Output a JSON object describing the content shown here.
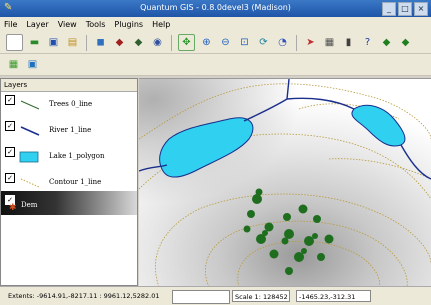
{
  "window": {
    "title": "Quantum GIS - 0.8.0devel3 (Madison)"
  },
  "menu": [
    "File",
    "Layer",
    "View",
    "Tools",
    "Plugins",
    "Help"
  ],
  "toolbar1": [
    "new-project",
    "open-project",
    "save-project",
    "save-as",
    "print",
    "add-vector",
    "add-raster",
    "add-postgis",
    "pan",
    "zoom-in",
    "zoom-out",
    "zoom-full",
    "zoom-last",
    "refresh",
    "identify",
    "measure",
    "select",
    "whats-this",
    "capture-point",
    "capture-line"
  ],
  "toolbar2": [
    "grid-plugin",
    "map-plugin"
  ],
  "layers_panel": {
    "header": "Layers",
    "items": [
      {
        "name": "Trees 0_line",
        "checked": true,
        "symbol": "thin-line",
        "color": "#2d6b2d"
      },
      {
        "name": "River 1_line",
        "checked": true,
        "symbol": "line",
        "color": "#1a2f8c"
      },
      {
        "name": "Lake 1_polygon",
        "checked": true,
        "symbol": "polygon",
        "color": "#2fd0f0"
      },
      {
        "name": "Contour 1_line",
        "checked": true,
        "symbol": "dashed-line",
        "color": "#c8a840"
      },
      {
        "name": "Dem",
        "checked": true,
        "symbol": "raster",
        "selected": true
      }
    ]
  },
  "colors": {
    "river": "#1a2f8c",
    "lake": "#2fd0f0",
    "trees": "#1f6e1f",
    "contour": "#b89a3a"
  },
  "statusbar": {
    "extents": "Extents: -9614.91,-8217.11 : 9961.12,5282.01",
    "scale": "Scale 1: 128452",
    "coords": "-1465.23,-312.31"
  }
}
